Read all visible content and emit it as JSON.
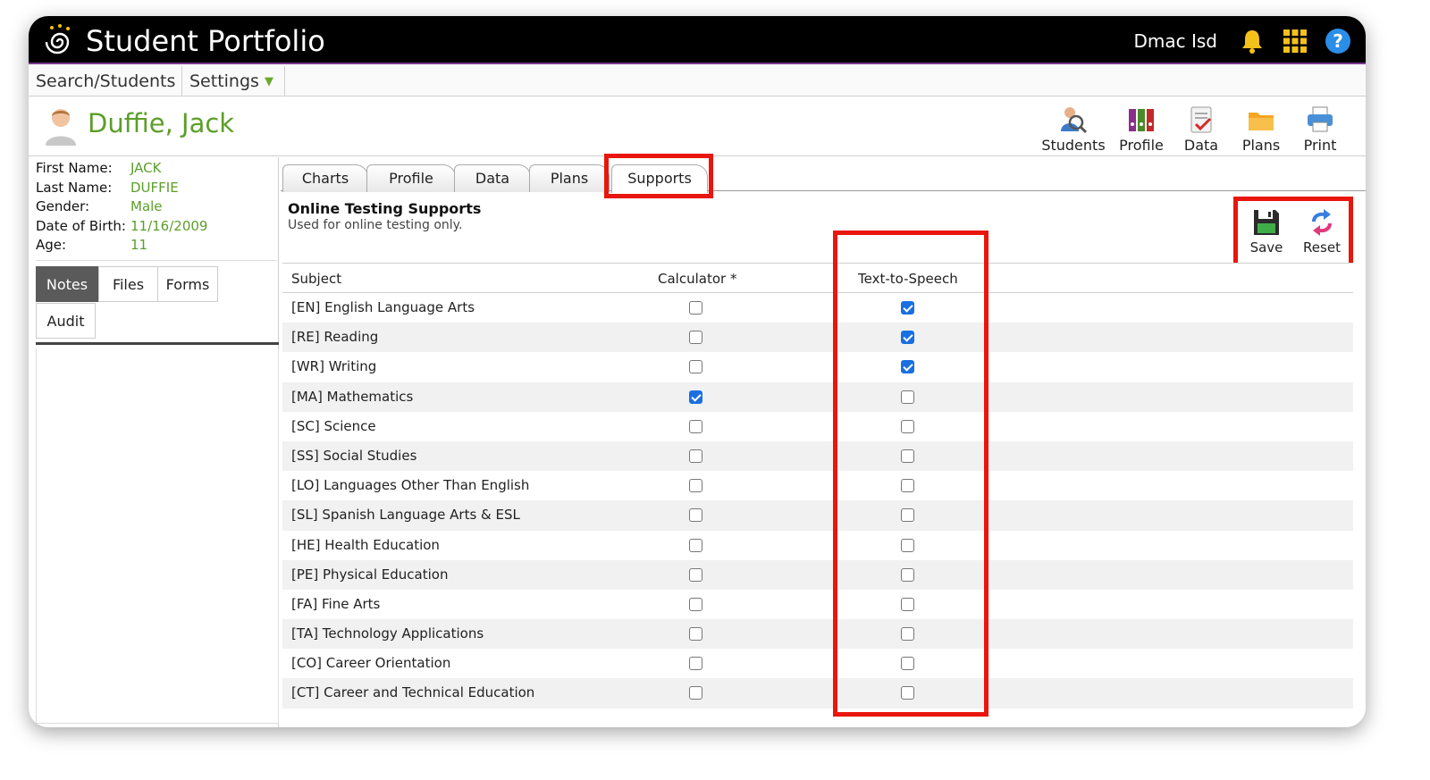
{
  "header": {
    "app_title": "Student Portfolio",
    "district": "Dmac Isd"
  },
  "menu": {
    "search_students": "Search/Students",
    "settings": "Settings"
  },
  "student": {
    "name": "Duffie, Jack",
    "info": [
      {
        "label": "First Name:",
        "value": "JACK"
      },
      {
        "label": "Last Name:",
        "value": "DUFFIE"
      },
      {
        "label": "Gender:",
        "value": "Male"
      },
      {
        "label": "Date of Birth:",
        "value": "11/16/2009"
      },
      {
        "label": "Age:",
        "value": "11"
      }
    ]
  },
  "toolbar": {
    "students": "Students",
    "profile": "Profile",
    "data": "Data",
    "plans": "Plans",
    "print": "Print"
  },
  "side_tabs": [
    "Notes",
    "Files",
    "Forms",
    "Audit"
  ],
  "tabs": [
    "Charts",
    "Profile",
    "Data",
    "Plans",
    "Supports"
  ],
  "active_tab": "Supports",
  "section": {
    "title": "Online Testing Supports",
    "subtitle": "Used for online testing only."
  },
  "actions": {
    "save": "Save",
    "reset": "Reset"
  },
  "table": {
    "headers": [
      "Subject",
      "Calculator *",
      "Text-to-Speech"
    ],
    "rows": [
      {
        "subject": "[EN] English Language Arts",
        "calculator": false,
        "tts": true
      },
      {
        "subject": "[RE] Reading",
        "calculator": false,
        "tts": true
      },
      {
        "subject": "[WR] Writing",
        "calculator": false,
        "tts": true
      },
      {
        "subject": "[MA] Mathematics",
        "calculator": true,
        "tts": false
      },
      {
        "subject": "[SC] Science",
        "calculator": false,
        "tts": false
      },
      {
        "subject": "[SS] Social Studies",
        "calculator": false,
        "tts": false
      },
      {
        "subject": "[LO] Languages Other Than English",
        "calculator": false,
        "tts": false
      },
      {
        "subject": "[SL] Spanish Language Arts & ESL",
        "calculator": false,
        "tts": false
      },
      {
        "subject": "[HE] Health Education",
        "calculator": false,
        "tts": false
      },
      {
        "subject": "[PE] Physical Education",
        "calculator": false,
        "tts": false
      },
      {
        "subject": "[FA] Fine Arts",
        "calculator": false,
        "tts": false
      },
      {
        "subject": "[TA] Technology Applications",
        "calculator": false,
        "tts": false
      },
      {
        "subject": "[CO] Career Orientation",
        "calculator": false,
        "tts": false
      },
      {
        "subject": "[CT] Career and Technical Education",
        "calculator": false,
        "tts": false
      }
    ]
  },
  "colors": {
    "accent_green": "#5c9e2a",
    "highlight_red": "#e8160c",
    "checkbox_blue": "#1a6fe0"
  }
}
